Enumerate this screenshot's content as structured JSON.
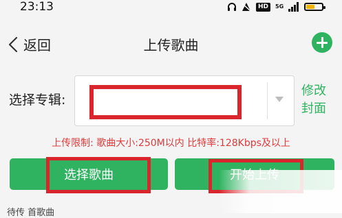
{
  "status": {
    "time": "23:13",
    "hd": "HD",
    "network": "5G"
  },
  "nav": {
    "back_label": "返回",
    "title": "上传歌曲"
  },
  "album": {
    "label": "选择专辑:",
    "selected": "",
    "cover_link": "修改封面"
  },
  "limit_text": "上传限制:  歌曲大小:250M以内  比特率:128Kbps及以上",
  "buttons": {
    "select_song": "选择歌曲",
    "start_upload": "开始上传"
  },
  "bottom_text": "待传 首歌曲",
  "colors": {
    "accent": "#2fb360",
    "highlight": "#d9252c",
    "warning_text": "#e03a3a"
  }
}
